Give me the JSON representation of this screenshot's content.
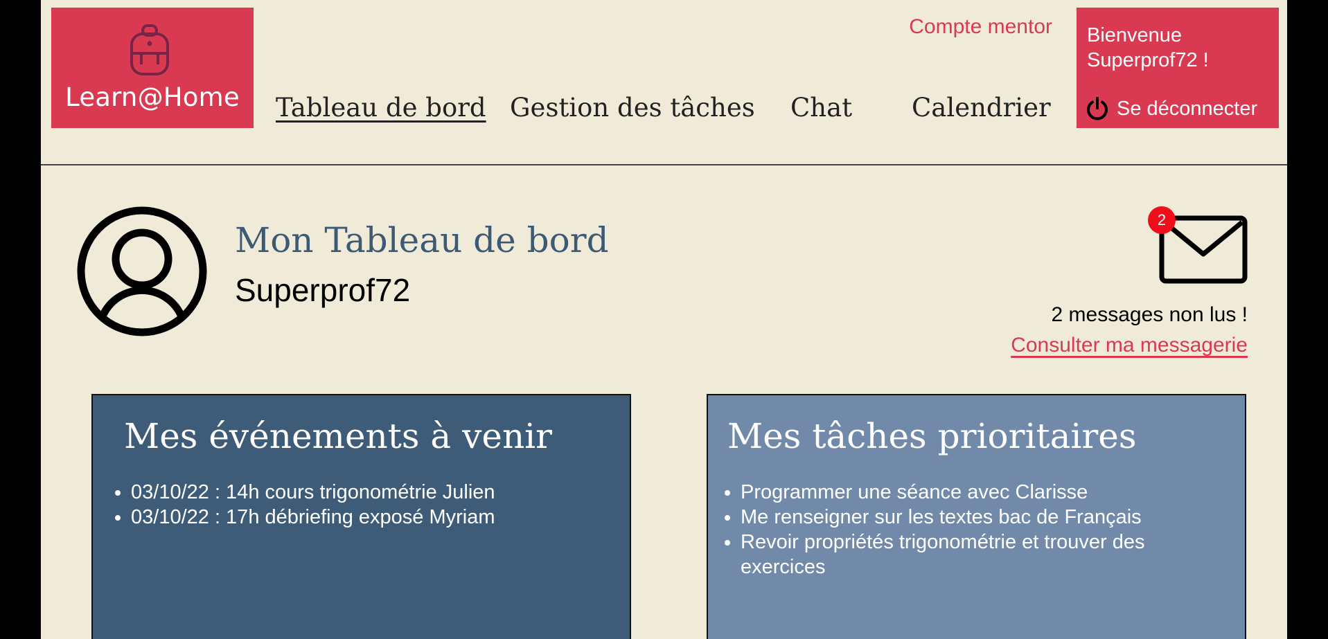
{
  "brand": {
    "name": "Learn@Home",
    "logo_icon": "backpack-icon",
    "color": "#d93a52"
  },
  "header": {
    "mentor_link": "Compte mentor",
    "welcome_line1": "Bienvenue",
    "welcome_line2": "Superprof72 !",
    "logout_label": "Se déconnecter"
  },
  "nav": {
    "items": [
      {
        "label": "Tableau de bord",
        "active": true
      },
      {
        "label": "Gestion des tâches",
        "active": false
      },
      {
        "label": "Chat",
        "active": false
      },
      {
        "label": "Calendrier",
        "active": false
      }
    ]
  },
  "dashboard": {
    "title": "Mon Tableau de bord",
    "username": "Superprof72"
  },
  "messages": {
    "badge_count": "2",
    "unread_text": "2 messages non lus !",
    "consult_link": "Consulter ma messagerie"
  },
  "events": {
    "title": "Mes événements à venir",
    "items": [
      "03/10/22 : 14h cours trigonométrie Julien",
      "03/10/22 : 17h débriefing exposé Myriam"
    ]
  },
  "tasks": {
    "title": "Mes tâches prioritaires",
    "items": [
      "Programmer une séance avec Clarisse",
      "Me renseigner sur les textes bac de Français",
      "Revoir propriétés trigonométrie et trouver des exercices"
    ]
  },
  "colors": {
    "background": "#f0ebd8",
    "events_card": "#3e5c77",
    "tasks_card": "#728aaa",
    "title_blue": "#3d5a75",
    "badge_red": "#ef0f1a"
  }
}
